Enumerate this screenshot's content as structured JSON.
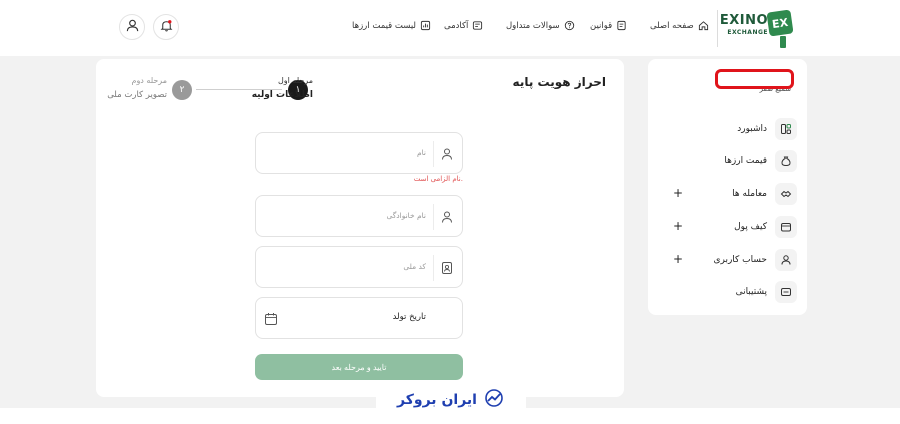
{
  "brand": {
    "name": "EXINO",
    "sub": "EXCHANGE",
    "badge": "EX",
    "color": "#2f8a4e"
  },
  "nav": {
    "home": "صفحه اصلی",
    "rules": "قوانین",
    "faq": "سوالات متداول",
    "academy": "آکادمی",
    "prices": "لیست قیمت ارزها"
  },
  "sidebar": {
    "user_label": "سمیع صفر",
    "items": [
      {
        "label": "داشبورد",
        "icon": "dashboard-icon",
        "expandable": false
      },
      {
        "label": "قیمت ارزها",
        "icon": "coin-bag-icon",
        "expandable": false
      },
      {
        "label": "معامله ها",
        "icon": "exchange-icon",
        "expandable": true
      },
      {
        "label": "کیف پول",
        "icon": "wallet-icon",
        "expandable": true
      },
      {
        "label": "حساب کاربری",
        "icon": "user-icon",
        "expandable": true
      },
      {
        "label": "پشتیبانی",
        "icon": "support-icon",
        "expandable": false
      }
    ],
    "expand_glyph": "+"
  },
  "main": {
    "title": "احراز هویت پایه",
    "steps": [
      {
        "number": "۱",
        "label": "مرحله اول",
        "sublabel": "اطلاعات اولیه",
        "state": "active"
      },
      {
        "number": "۲",
        "label": "مرحله دوم",
        "sublabel": "تصویر کارت ملی",
        "state": "inactive"
      }
    ],
    "fields": {
      "first_name": {
        "placeholder": "نام",
        "value": ""
      },
      "first_name_error": "نام الزامی است.",
      "last_name": {
        "placeholder": "نام خانوادگی",
        "value": ""
      },
      "national_code": {
        "placeholder": "کد ملی",
        "value": ""
      },
      "birth_date": {
        "label": "تاریخ تولد"
      }
    },
    "submit_label": "تایید و مرحله بعد"
  },
  "watermark": {
    "text": "ایران بروکر",
    "color": "#1f3fb0"
  },
  "colors": {
    "accent": "#2f8a4e",
    "submit_disabled": "#8fbfa1",
    "error": "#e05050",
    "annotation": "#e0141b"
  }
}
